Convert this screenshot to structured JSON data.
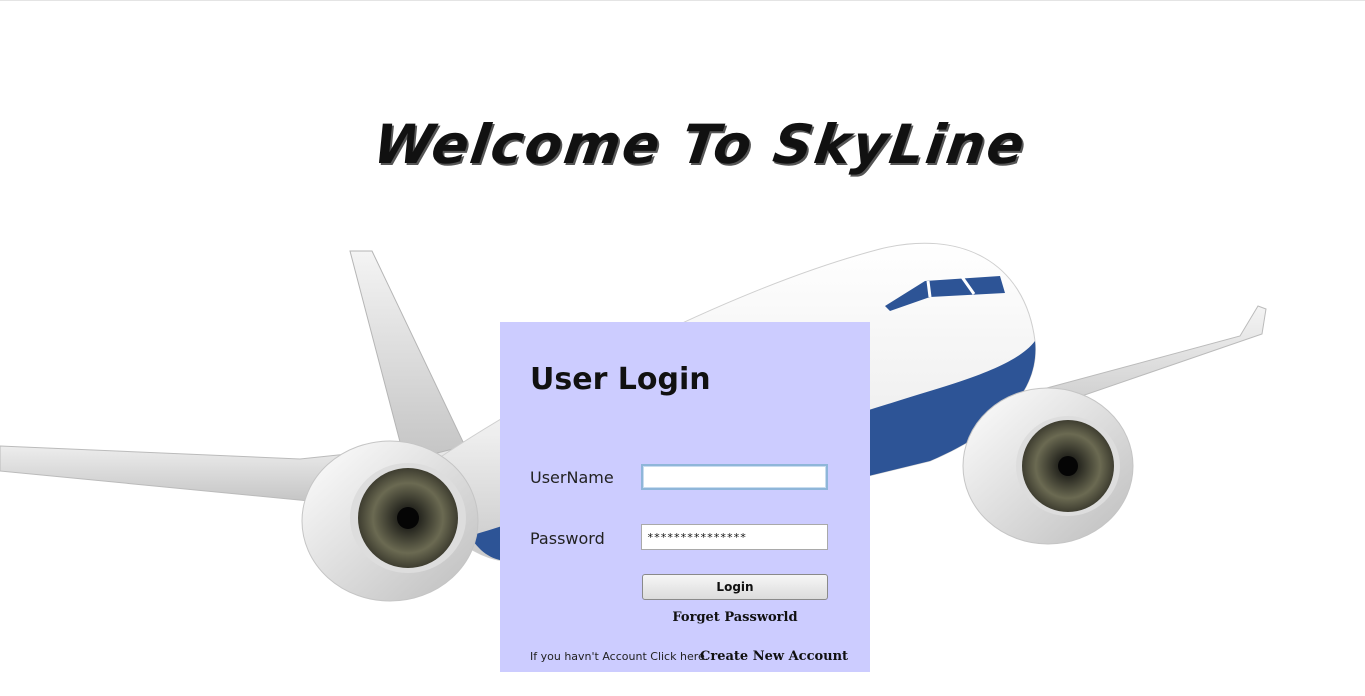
{
  "header": {
    "welcome_text": "Welcome To SkyLine"
  },
  "login": {
    "title": "User Login",
    "username_label": "UserName",
    "username_value": "",
    "password_label": "Password",
    "password_value": "***************",
    "login_button": "Login",
    "forget_password": "Forget Passworld",
    "no_account_text": "If you havn't Account Click here.",
    "create_account": "Create New Account"
  },
  "colors": {
    "panel_background": "#ccccff",
    "plane_stripe": "#2d5496",
    "page_background": "#ffffff"
  },
  "icons": {
    "background_image": "airplane-illustration"
  }
}
